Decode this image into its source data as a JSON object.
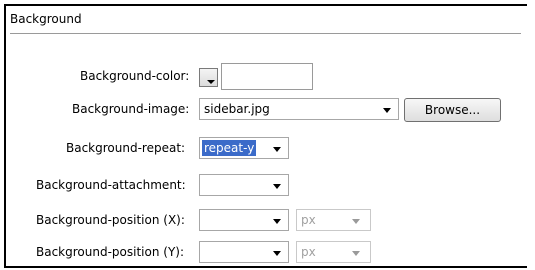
{
  "section": {
    "title": "Background"
  },
  "fields": {
    "color": {
      "label": "Background-color:",
      "value": ""
    },
    "image": {
      "label": "Background-image:",
      "value": "sidebar.jpg",
      "browse_label": "Browse..."
    },
    "repeat": {
      "label": "Background-repeat:",
      "value": "repeat-y"
    },
    "attachment": {
      "label": "Background-attachment:",
      "value": ""
    },
    "position_x": {
      "label": "Background-position (X):",
      "value": "",
      "unit": "px"
    },
    "position_y": {
      "label": "Background-position (Y):",
      "value": "",
      "unit": "px"
    }
  }
}
